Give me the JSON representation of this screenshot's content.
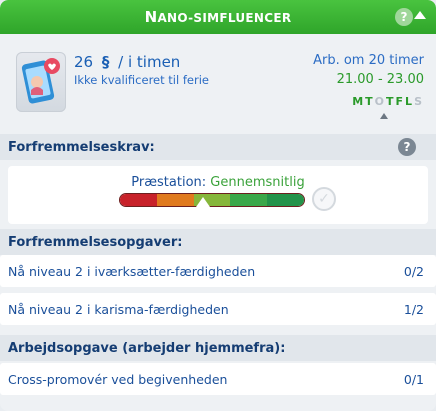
{
  "header": {
    "title": "Nano-simfluencer",
    "help_label": "?"
  },
  "info": {
    "pay_amount": "26",
    "pay_currency": "§",
    "pay_suffix": "/ i timen",
    "vacation_note": "Ikke kvalificeret til ferie",
    "work_in": "Arb. om 20 timer",
    "hours": "21.00 - 23.00",
    "days": [
      {
        "letter": "M",
        "active": true
      },
      {
        "letter": "T",
        "active": true
      },
      {
        "letter": "O",
        "active": false
      },
      {
        "letter": "T",
        "active": true
      },
      {
        "letter": "F",
        "active": true
      },
      {
        "letter": "L",
        "active": true
      },
      {
        "letter": "S",
        "active": false
      }
    ]
  },
  "promotion": {
    "title": "Forfremmelseskrav:",
    "help_label": "?",
    "performance_key": "Præstation:",
    "performance_value": "Gennemsnitlig",
    "meter_colors": [
      "#c8222a",
      "#e07a1e",
      "#86b63a",
      "#3ba84a",
      "#23934a"
    ]
  },
  "promotion_tasks": {
    "title": "Forfremmelsesopgaver:",
    "items": [
      {
        "label": "Nå niveau 2 i iværksætter-færdigheden",
        "count": "0/2"
      },
      {
        "label": "Nå niveau 2 i karisma-færdigheden",
        "count": "1/2"
      }
    ]
  },
  "work_task": {
    "title": "Arbejdsopgave (arbejder hjemmefra):",
    "items": [
      {
        "label": "Cross-promovér ved begivenheden",
        "count": "0/1"
      }
    ]
  }
}
